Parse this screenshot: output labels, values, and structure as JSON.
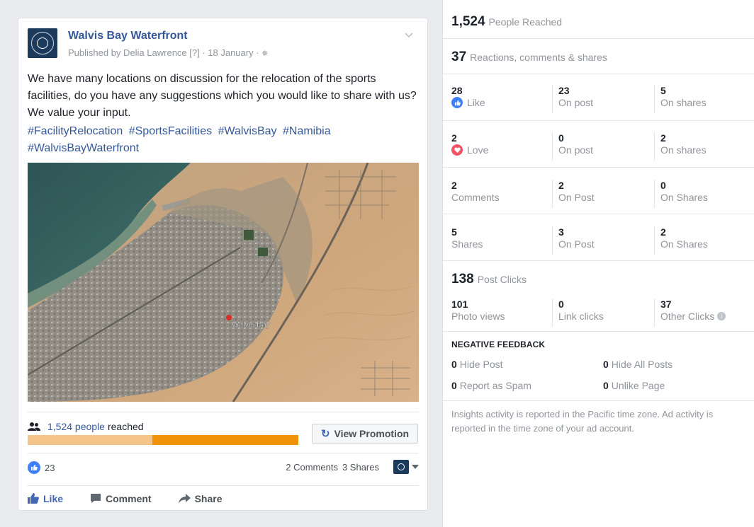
{
  "post": {
    "page_name": "Walvis Bay Waterfront",
    "published_by": "Published by Delia Lawrence [?] · 18 January · ",
    "text": "We have many locations on discussion for the relocation of the sports facilities, do you have any suggestions which you would like to share with us? We value your input.",
    "hashtags": [
      "#FacilityRelocation",
      "#SportsFacilities",
      "#WalvisBay",
      "#Namibia",
      "#WalvisBayWaterfront"
    ],
    "image_label": "Walvis Bay",
    "reach": {
      "count_text": "1,524 people",
      "suffix": "reached",
      "bar_paid_fraction": 0.54
    },
    "view_promotion_label": "View Promotion",
    "likes": "23",
    "comments": "2 Comments",
    "shares": "3 Shares",
    "actions": {
      "like": "Like",
      "comment": "Comment",
      "share": "Share"
    }
  },
  "insights": {
    "people_reached": {
      "value": "1,524",
      "label": "People Reached"
    },
    "engagement": {
      "value": "37",
      "label": "Reactions, comments & shares"
    },
    "rows": [
      {
        "total": "28",
        "label": "Like",
        "on_post": "23",
        "on_post_label": "On post",
        "on_shares": "5",
        "on_shares_label": "On shares",
        "icon": "like-icon"
      },
      {
        "total": "2",
        "label": "Love",
        "on_post": "0",
        "on_post_label": "On post",
        "on_shares": "2",
        "on_shares_label": "On shares",
        "icon": "love-icon"
      },
      {
        "total": "2",
        "label": "Comments",
        "on_post": "2",
        "on_post_label": "On Post",
        "on_shares": "0",
        "on_shares_label": "On Shares"
      },
      {
        "total": "5",
        "label": "Shares",
        "on_post": "3",
        "on_post_label": "On Post",
        "on_shares": "2",
        "on_shares_label": "On Shares"
      }
    ],
    "post_clicks": {
      "value": "138",
      "label": "Post Clicks"
    },
    "clicks": [
      {
        "value": "101",
        "label": "Photo views"
      },
      {
        "value": "0",
        "label": "Link clicks"
      },
      {
        "value": "37",
        "label": "Other Clicks"
      }
    ],
    "negative": {
      "title": "NEGATIVE FEEDBACK",
      "items": [
        {
          "value": "0",
          "label": "Hide Post"
        },
        {
          "value": "0",
          "label": "Hide All Posts"
        },
        {
          "value": "0",
          "label": "Report as Spam"
        },
        {
          "value": "0",
          "label": "Unlike Page"
        }
      ]
    },
    "footnote": "Insights activity is reported in the Pacific time zone. Ad activity is reported in the time zone of your ad account."
  },
  "colors": {
    "link_blue": "#365899",
    "like_blue": "#4080ff",
    "love_red": "#f25268",
    "bar_organic": "#f5c489",
    "bar_paid": "#f0930b"
  }
}
